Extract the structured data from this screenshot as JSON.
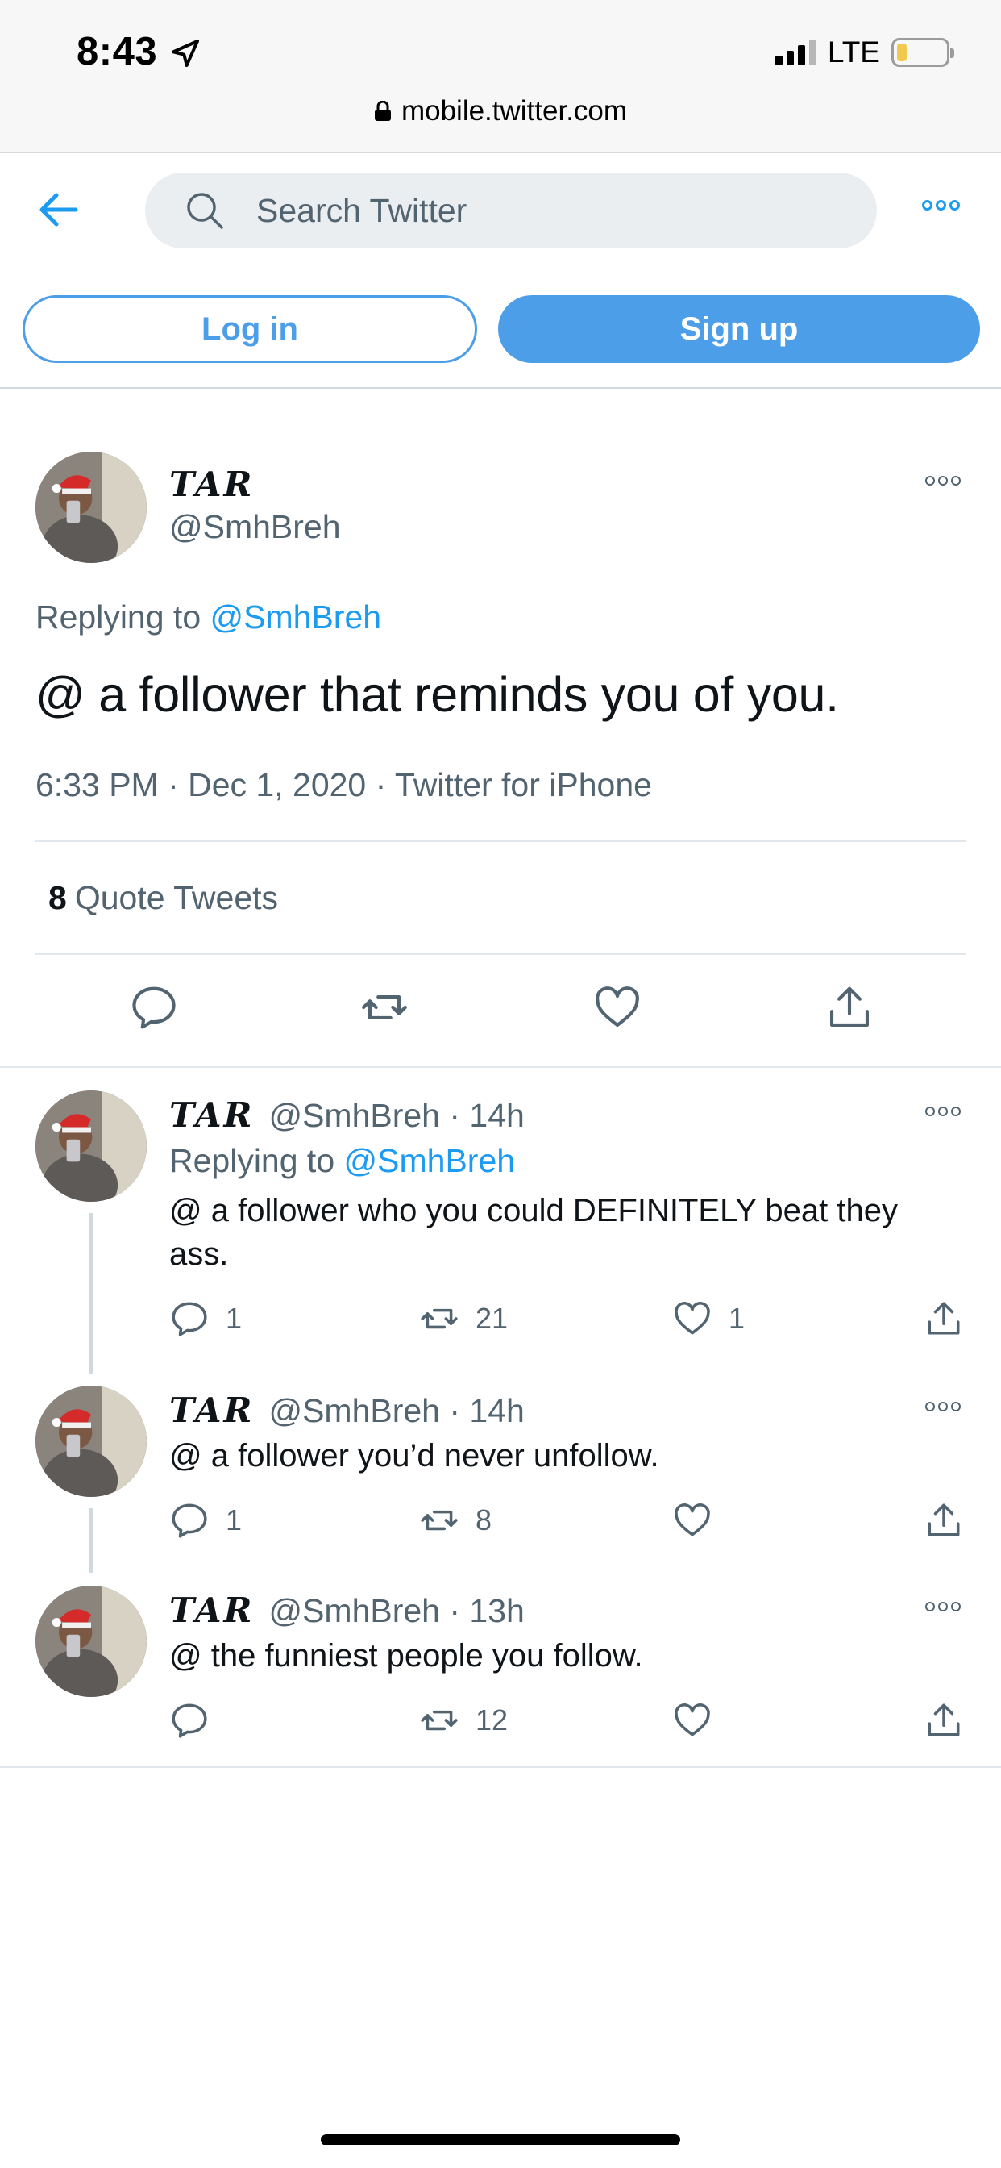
{
  "status_bar": {
    "time": "8:43",
    "network": "LTE",
    "battery_level": 0.2
  },
  "browser": {
    "url": "mobile.twitter.com"
  },
  "header": {
    "search_placeholder": "Search Twitter",
    "login_label": "Log in",
    "signup_label": "Sign up"
  },
  "main_tweet": {
    "name": "TAR",
    "handle": "@SmhBreh",
    "replying_prefix": "Replying to",
    "replying_to": "@SmhBreh",
    "text": "@ a follower that reminds you of you.",
    "meta": "6:33 PM · Dec 1, 2020 · Twitter for iPhone",
    "quote_count": "8",
    "quote_label": "Quote Tweets"
  },
  "replies": [
    {
      "name": "TAR",
      "handle_time": "@SmhBreh · 14h",
      "replying_prefix": "Replying to",
      "replying_to": "@SmhBreh",
      "text": "@ a follower who you could DEFINITELY beat they ass.",
      "reply_count": "1",
      "retweet_count": "21",
      "like_count": "1"
    },
    {
      "name": "TAR",
      "handle_time": "@SmhBreh · 14h",
      "text": "@ a follower you’d never unfollow.",
      "reply_count": "1",
      "retweet_count": "8",
      "like_count": ""
    },
    {
      "name": "TAR",
      "handle_time": "@SmhBreh · 13h",
      "text": "@ the funniest people you follow.",
      "reply_count": "",
      "retweet_count": "12",
      "like_count": ""
    }
  ],
  "colors": {
    "accent": "#1d9bf0",
    "button_blue": "#4c9ee8",
    "muted": "#536471",
    "divider": "#e1e8ed"
  }
}
